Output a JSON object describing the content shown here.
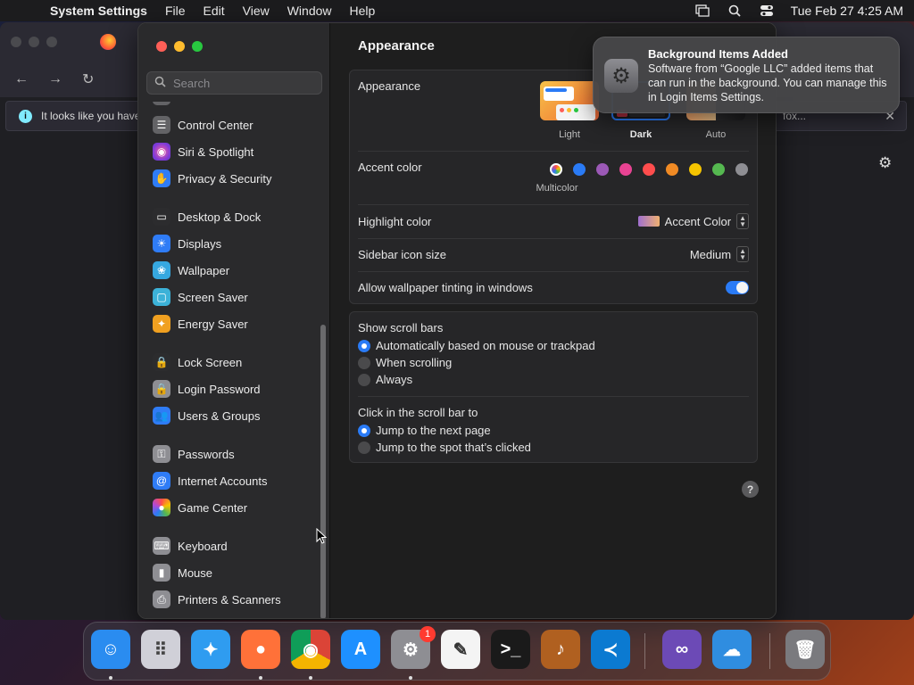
{
  "menubar": {
    "app_name": "System Settings",
    "menus": [
      "File",
      "Edit",
      "View",
      "Window",
      "Help"
    ],
    "clock": "Tue Feb 27  4:25 AM"
  },
  "browser": {
    "info_text": "It looks like you have",
    "info_tail": "fox..."
  },
  "sidebar": {
    "search_placeholder": "Search",
    "items": [
      {
        "label": "Control Center",
        "icon": "control-center-icon",
        "color": "#636366"
      },
      {
        "label": "Siri & Spotlight",
        "icon": "siri-icon",
        "color": "#b04ad8"
      },
      {
        "label": "Privacy & Security",
        "icon": "hand-icon",
        "color": "#2f7cf6"
      },
      {
        "label": "Desktop & Dock",
        "icon": "desktop-icon",
        "color": "#2c2c2e"
      },
      {
        "label": "Displays",
        "icon": "sun-icon",
        "color": "#2f7cf6"
      },
      {
        "label": "Wallpaper",
        "icon": "flower-icon",
        "color": "#36a8e0"
      },
      {
        "label": "Screen Saver",
        "icon": "screen-saver-icon",
        "color": "#3cb2d8"
      },
      {
        "label": "Energy Saver",
        "icon": "lightbulb-icon",
        "color": "#f0a020"
      },
      {
        "label": "Lock Screen",
        "icon": "lock-icon",
        "color": "#2c2c2e"
      },
      {
        "label": "Login Password",
        "icon": "lock-icon",
        "color": "#8e8e93"
      },
      {
        "label": "Users & Groups",
        "icon": "users-icon",
        "color": "#2f7cf6"
      },
      {
        "label": "Passwords",
        "icon": "key-icon",
        "color": "#8e8e93"
      },
      {
        "label": "Internet Accounts",
        "icon": "at-icon",
        "color": "#2f7cf6"
      },
      {
        "label": "Game Center",
        "icon": "game-center-icon",
        "color": "#e8e8e8"
      },
      {
        "label": "Keyboard",
        "icon": "keyboard-icon",
        "color": "#8e8e93"
      },
      {
        "label": "Mouse",
        "icon": "mouse-icon",
        "color": "#8e8e93"
      },
      {
        "label": "Printers & Scanners",
        "icon": "printer-icon",
        "color": "#8e8e93"
      }
    ]
  },
  "content": {
    "title": "Appearance",
    "appearance_label": "Appearance",
    "modes": [
      "Light",
      "Dark",
      "Auto"
    ],
    "selected_mode": "Dark",
    "accent_label": "Accent color",
    "accent_colors": [
      "#2a7bf6",
      "#9b59b6",
      "#e84393",
      "#ff4d4d",
      "#f08a24",
      "#f5c400",
      "#55b850",
      "#8e8e93"
    ],
    "accent_selected_name": "Multicolor",
    "highlight_label": "Highlight color",
    "highlight_value": "Accent Color",
    "sidebar_icon_label": "Sidebar icon size",
    "sidebar_icon_value": "Medium",
    "tinting_label": "Allow wallpaper tinting in windows",
    "tinting_on": true,
    "scrollbars_label": "Show scroll bars",
    "scrollbar_options": [
      "Automatically based on mouse or trackpad",
      "When scrolling",
      "Always"
    ],
    "click_label": "Click in the scroll bar to",
    "click_options": [
      "Jump to the next page",
      "Jump to the spot that’s clicked"
    ],
    "help": "?"
  },
  "notification": {
    "title": "Background Items Added",
    "body": "Software from “Google LLC” added items that can run in the background. You can manage this in Login Items Settings."
  },
  "dock": {
    "items": [
      {
        "name": "finder",
        "color": "#2a8cf0"
      },
      {
        "name": "launchpad",
        "color": "#d0d0d8"
      },
      {
        "name": "safari",
        "color": "#2f9cf0"
      },
      {
        "name": "firefox",
        "color": "#ff7139"
      },
      {
        "name": "chrome",
        "color": "#4285f4"
      },
      {
        "name": "app-store",
        "color": "#1e90ff"
      },
      {
        "name": "system-settings",
        "color": "#8e8e93",
        "badge": "1"
      },
      {
        "name": "textedit",
        "color": "#f4f4f4"
      },
      {
        "name": "terminal",
        "color": "#1a1a1a"
      },
      {
        "name": "garageband",
        "color": "#b06020"
      },
      {
        "name": "vscode",
        "color": "#0b7ad1"
      },
      {
        "name": "visual-studio",
        "color": "#6c4ab6"
      },
      {
        "name": "weather",
        "color": "#2f8de0"
      },
      {
        "name": "trash",
        "color": "#7a7a7e"
      }
    ]
  }
}
